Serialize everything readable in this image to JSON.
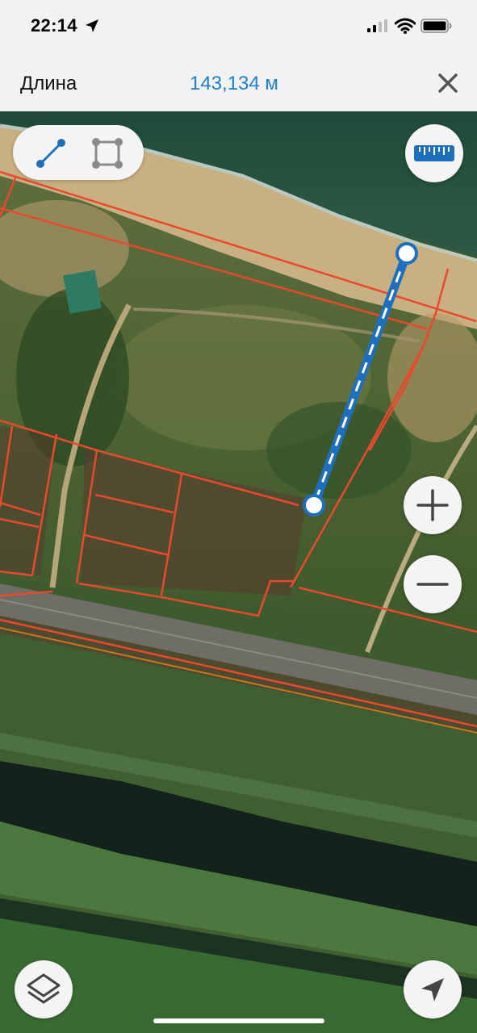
{
  "status_bar": {
    "time": "22:14",
    "icons": [
      "location-arrow-icon",
      "cellular-signal-icon",
      "wifi-icon",
      "battery-icon"
    ]
  },
  "header": {
    "title": "Длина",
    "measurement": "143,134 м",
    "close_icon": "close-icon"
  },
  "map": {
    "type": "satellite",
    "parcel_outline_color": "#e8492f",
    "measure_line_color": "#1f6fbf"
  },
  "controls": {
    "tools": [
      "line-measure-icon",
      "area-measure-icon"
    ],
    "ruler": "ruler-icon",
    "zoom_in": "plus-icon",
    "zoom_out": "minus-icon",
    "layers": "layers-icon",
    "locate": "navigation-arrow-icon"
  },
  "colors": {
    "accent": "#1f7fc8",
    "bar_bg": "#f2f2f5",
    "button_bg": "#f4f4f4"
  }
}
